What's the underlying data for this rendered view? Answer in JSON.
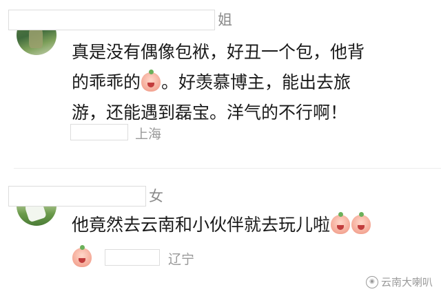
{
  "comments": [
    {
      "name_suffix": "姐",
      "text_lines": [
        "真是没有偶像包袱，好丑一个包，他背",
        "的乖乖的",
        "。好羡慕博主，能出去旅",
        "游，还能遇到磊宝。洋气的不行啊！"
      ],
      "emoji": "crying-peach-emoji",
      "location": "上海"
    },
    {
      "name_suffix": "女",
      "text": "他竟然去云南和小伙伴就去玩儿啦",
      "emoji": "shy-peach-emoji",
      "location": "辽宁"
    }
  ],
  "watermark": {
    "icon": "weibo-icon",
    "text": "云南大喇叭"
  },
  "colors": {
    "text": "#1a1a1a",
    "muted": "#999999",
    "peach": "#f4a896"
  }
}
